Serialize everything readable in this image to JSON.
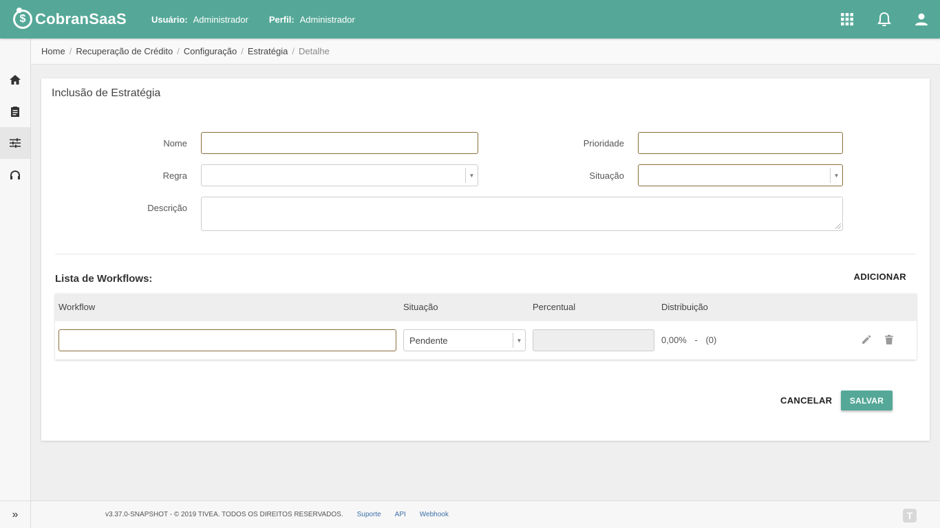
{
  "header": {
    "logo_mark": "$",
    "logo_text": "CobranSaaS",
    "user_label": "Usuário:",
    "user_value": "Administrador",
    "profile_label": "Perfil:",
    "profile_value": "Administrador",
    "icons": [
      "apps-grid-icon",
      "bell-icon",
      "user-icon"
    ]
  },
  "sidebar": {
    "items": [
      {
        "icon": "home-icon",
        "active": false
      },
      {
        "icon": "clipboard-icon",
        "active": false
      },
      {
        "icon": "sliders-icon",
        "active": true
      },
      {
        "icon": "headset-icon",
        "active": false
      }
    ],
    "expand_glyph": "»"
  },
  "breadcrumb": {
    "items": [
      "Home",
      "Recuperação de Crédito",
      "Configuração",
      "Estratégia"
    ],
    "current": "Detalhe",
    "separator": "/"
  },
  "form": {
    "title": "Inclusão de Estratégia",
    "nome_label": "Nome",
    "nome_value": "",
    "prioridade_label": "Prioridade",
    "prioridade_value": "",
    "regra_label": "Regra",
    "regra_value": "",
    "situacao_label": "Situação",
    "situacao_value": "",
    "descricao_label": "Descrição",
    "descricao_value": "",
    "select_arrow": "▼"
  },
  "workflows": {
    "title": "Lista de Workflows:",
    "add_label": "ADICIONAR",
    "columns": [
      "Workflow",
      "Situação",
      "Percentual",
      "Distribuição"
    ],
    "rows": [
      {
        "workflow": "",
        "situacao": "Pendente",
        "percentual": "",
        "distribuicao_pct": "0,00%",
        "distribuicao_sep": "-",
        "distribuicao_count": "(0)"
      }
    ]
  },
  "actions": {
    "cancel_label": "CANCELAR",
    "save_label": "SALVAR"
  },
  "footer": {
    "version": "v3.37.0-SNAPSHOT - © 2019 TIVEA. TODOS OS DIREITOS RESERVADOS.",
    "links": [
      "Suporte",
      "API",
      "Webhook"
    ],
    "logo_mark": "T"
  },
  "colors": {
    "primary": "#55a898",
    "input_border": "#8b6d3a"
  }
}
